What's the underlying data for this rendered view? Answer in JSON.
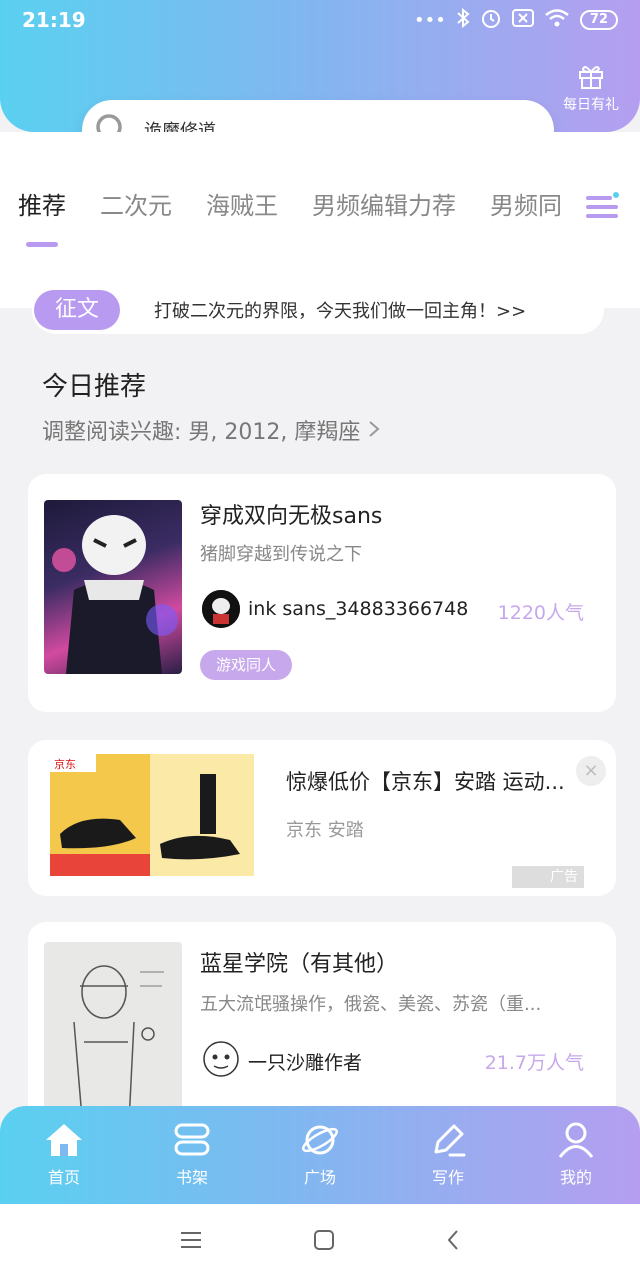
{
  "status_bar": {
    "time": "21:19",
    "battery": "72",
    "icons": [
      "more-dots-icon",
      "bluetooth-icon",
      "alarm-icon",
      "sim-off-icon",
      "wifi-icon",
      "battery-icon"
    ]
  },
  "header": {
    "gift_label": "每日有礼",
    "search_value": "诡魔修道"
  },
  "tabs": [
    "推荐",
    "二次元",
    "海贼王",
    "男频编辑力荐",
    "男频同"
  ],
  "banner": {
    "tag": "征文",
    "text": "打破二次元的界限，今天我们做一回主角！>>"
  },
  "section": {
    "title": "今日推荐",
    "subtitle": "调整阅读兴趣: 男, 2012, 摩羯座"
  },
  "books": [
    {
      "title": "穿成双向无极sans",
      "desc": "猪脚穿越到传说之下",
      "author": "ink sans_34883366748",
      "popularity": "1220人气",
      "tag": "游戏同人"
    },
    {
      "title": "蓝星学院（有其他）",
      "desc": "五大流氓骚操作，俄瓷、美瓷、苏瓷（重...",
      "author": "一只沙雕作者",
      "popularity": "21.7万人气"
    }
  ],
  "ad": {
    "title": "惊爆低价【京东】安踏 运动...",
    "brand": "京东 安踏",
    "label": "广告",
    "close": "×"
  },
  "bottom_nav": [
    {
      "label": "首页",
      "icon": "home-icon"
    },
    {
      "label": "书架",
      "icon": "bookshelf-icon"
    },
    {
      "label": "广场",
      "icon": "planet-icon"
    },
    {
      "label": "写作",
      "icon": "write-icon"
    },
    {
      "label": "我的",
      "icon": "profile-icon"
    }
  ],
  "colors": {
    "gradient_start": "#5ad0f0",
    "gradient_end": "#b59ef0",
    "accent": "#b89af0",
    "popularity": "#c7a8ec"
  }
}
